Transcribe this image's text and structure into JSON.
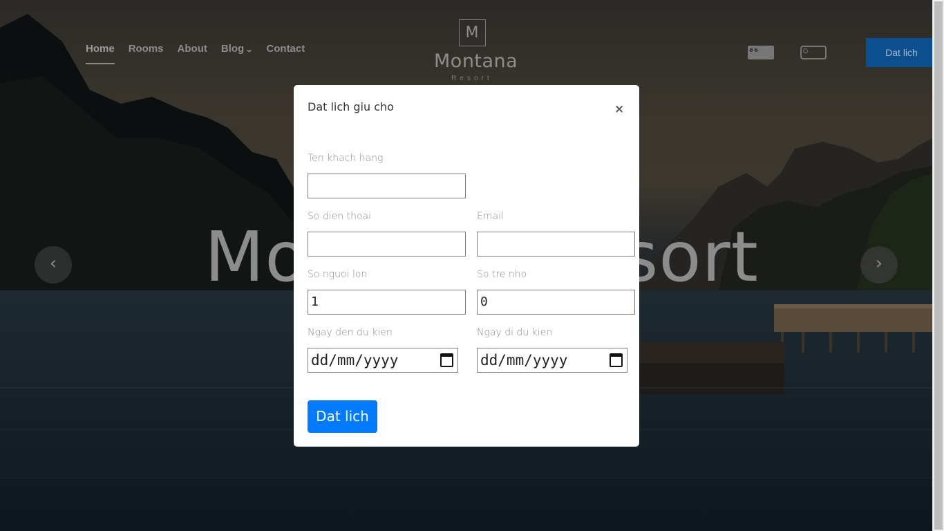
{
  "nav": {
    "items": [
      {
        "label": "Home"
      },
      {
        "label": "Rooms"
      },
      {
        "label": "About"
      },
      {
        "label": "Blog"
      },
      {
        "label": "Contact"
      }
    ]
  },
  "logo": {
    "mark": "M",
    "name": "Montana",
    "sub": "Resort"
  },
  "header": {
    "book_label": "Dat lich"
  },
  "hero": {
    "title": "Montana Resort"
  },
  "modal": {
    "title": "Dat lich giu cho",
    "close": "×",
    "fields": {
      "name_label": "Ten khach hang",
      "name_value": "",
      "phone_label": "So dien thoai",
      "phone_value": "",
      "email_label": "Email",
      "email_value": "",
      "adults_label": "So nguoi lon",
      "adults_value": "1",
      "children_label": "So tre nho",
      "children_value": "0",
      "arrival_label": "Ngay den du kien",
      "arrival_value": "dd/mm/yyyy",
      "departure_label": "Ngay di du kien",
      "departure_value": "dd/mm/yyyy"
    },
    "submit_label": "Dat lich"
  },
  "colors": {
    "primary": "#007bff",
    "header_button": "#0b4f90"
  },
  "icons": {
    "social": [
      "facebook-icon",
      "twitter-icon",
      "instagram-icon",
      "tripadvisor-icon"
    ]
  }
}
